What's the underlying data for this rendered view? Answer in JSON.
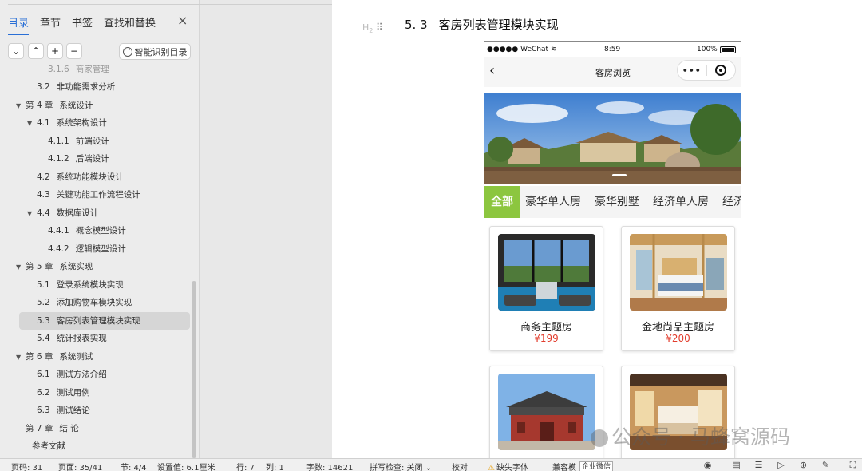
{
  "sidebar": {
    "tabs": [
      "目录",
      "章节",
      "书签",
      "查找和替换"
    ],
    "close": "×",
    "tools": {
      "collapse": "⌄",
      "expand": "⌃",
      "add": "+",
      "remove": "−"
    },
    "smart_label": "智能识别目录",
    "toc": [
      {
        "num": "3.1.6",
        "text": "商家管理",
        "level": 3
      },
      {
        "num": "3.2",
        "text": "非功能需求分析",
        "level": 2
      },
      {
        "num": "第 4 章",
        "text": "系统设计",
        "level": 1,
        "arrow": true
      },
      {
        "num": "4.1",
        "text": "系统架构设计",
        "level": 2,
        "arrow": true
      },
      {
        "num": "4.1.1",
        "text": "前端设计",
        "level": 3
      },
      {
        "num": "4.1.2",
        "text": "后端设计",
        "level": 3
      },
      {
        "num": "4.2",
        "text": "系统功能模块设计",
        "level": 2
      },
      {
        "num": "4.3",
        "text": "关键功能工作流程设计",
        "level": 2
      },
      {
        "num": "4.4",
        "text": "数据库设计",
        "level": 2,
        "arrow": true
      },
      {
        "num": "4.4.1",
        "text": "概念模型设计",
        "level": 3
      },
      {
        "num": "4.4.2",
        "text": "逻辑模型设计",
        "level": 3
      },
      {
        "num": "第 5 章",
        "text": "系统实现",
        "level": 1,
        "arrow": true
      },
      {
        "num": "5.1",
        "text": "登录系统模块实现",
        "level": 2
      },
      {
        "num": "5.2",
        "text": "添加购物车模块实现",
        "level": 2
      },
      {
        "num": "5.3",
        "text": "客房列表管理模块实现",
        "level": 2,
        "selected": true
      },
      {
        "num": "5.4",
        "text": "统计报表实现",
        "level": 2
      },
      {
        "num": "第 6 章",
        "text": "系统测试",
        "level": 1,
        "arrow": true
      },
      {
        "num": "6.1",
        "text": "测试方法介绍",
        "level": 2
      },
      {
        "num": "6.2",
        "text": "测试用例",
        "level": 2
      },
      {
        "num": "6.3",
        "text": "测试结论",
        "level": 2
      },
      {
        "num": "第 7 章",
        "text": "结    论",
        "level": 1
      },
      {
        "num": "",
        "text": "参考文献",
        "level": 1
      }
    ]
  },
  "document": {
    "heading_mark": "H",
    "heading_mark_sub": "2",
    "heading_num": "5. 3",
    "heading_text": "客房列表管理模块实现"
  },
  "phone": {
    "carrier": "●●●●● WeChat",
    "wifi": "≋",
    "time": "8:59",
    "battery": "100%",
    "back": "‹",
    "title": "客房浏览",
    "menu": "•••",
    "categories": [
      "全部",
      "豪华单人房",
      "豪华别墅",
      "经济单人房",
      "经济"
    ],
    "rooms": [
      {
        "name": "商务主题房",
        "price": "¥199"
      },
      {
        "name": "金地尚品主题房",
        "price": "¥200"
      },
      {
        "name": "",
        "price": ""
      },
      {
        "name": "",
        "price": ""
      }
    ]
  },
  "watermark": "公众号 · 马蜂窝源码",
  "status": {
    "page": "页码: 31",
    "pages": "页面: 35/41",
    "section": "节: 4/4",
    "setting": "设置值: 6.1厘米",
    "row": "行: 7",
    "col": "列: 1",
    "words": "字数: 14621",
    "spell": "拼写检查: 关闭",
    "spell_arrow": "⌄",
    "proof": "校对",
    "missing_font": "缺失字体",
    "compat": "兼容模",
    "tooltip": "企业微信"
  },
  "colors": {
    "accent": "#2a6fd6",
    "category_active": "#8cc63f",
    "price": "#e23c2c",
    "selection": "#d6d6d6"
  }
}
